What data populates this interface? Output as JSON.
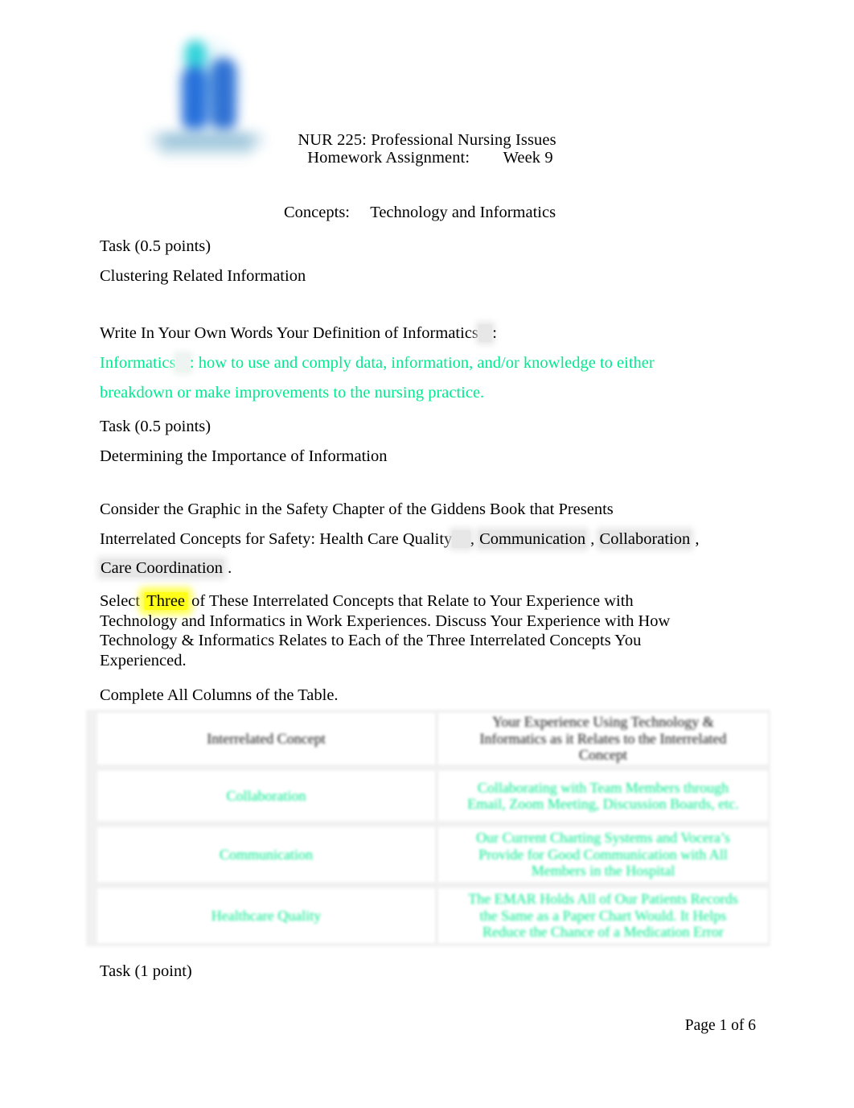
{
  "colors": {
    "green_text": "#00e98e",
    "yellow_highlight": "#ffff1a",
    "gray_highlight": "#e4e4e4",
    "logo_cyan": "#1ecfd6",
    "logo_blue": "#1565d8",
    "page_background": "#ffffff",
    "body_text": "#000000"
  },
  "logo": {
    "name": "institution-logo",
    "description": "blurred blue and cyan abstract mark with wordmark beneath"
  },
  "header": {
    "line1": "NUR 225: Professional Nursing Issues",
    "line2": "Homework Assignment:        Week 9",
    "concepts_label": "Concepts:",
    "concepts_value": "Technology and Informatics",
    "concepts_line": "Concepts:     Technology and Informatics"
  },
  "sections": [
    {
      "task_label": "Task (0.5 points)",
      "heading": "Clustering Related Information",
      "prompt_prefix": "Write In Your Own Words Your Definition of Informatics",
      "prompt_suffix": ":",
      "answer_term": "Informatics",
      "answer_body": ": how to use and comply data, information, and/or knowledge to either breakdown or make improvements to the nursing practice."
    },
    {
      "task_label": "Task (0.5 points)",
      "heading": "Determining the Importance of Information",
      "consider_line1": "Consider the Graphic in the Safety Chapter of the Giddens Book that Presents",
      "consider_line2_prefix": "Interrelated Concepts for Safety: Health Care Quality",
      "consider_concept_2": "Communication",
      "consider_concept_3": "Collaboration",
      "consider_concept_4": "Care Coordination",
      "select_prefix": "Select",
      "select_highlight": "Three",
      "select_body": "of These Interrelated Concepts that Relate to Your Experience with Technology and Informatics in Work Experiences. Discuss Your Experience with How Technology & Informatics Relates to Each of the Three Interrelated Concepts You Experienced.",
      "complete_instruction": "Complete All Columns of the Table."
    }
  ],
  "table": {
    "headers": {
      "col1": "Interrelated Concept",
      "col2_lines": [
        "Your Experience Using Technology &",
        "Informatics as it Relates to the Interrelated",
        "Concept"
      ]
    },
    "rows": [
      {
        "concept": "Collaboration",
        "experience_lines": [
          "Collaborating with Team Members through",
          "Email, Zoom Meeting, Discussion Boards, etc."
        ]
      },
      {
        "concept": "Communication",
        "experience_lines": [
          "Our Current Charting Systems and Vocera’s",
          "Provide for Good Communication with All",
          "Members in the Hospital"
        ]
      },
      {
        "concept": "Healthcare Quality",
        "experience_lines": [
          "The EMAR Holds All of Our Patients Records",
          "the Same as a Paper Chart Would. It Helps",
          "Reduce the Chance of a Medication Error"
        ]
      }
    ]
  },
  "final_task": {
    "label": "Task (1 point)"
  },
  "footer": {
    "page_indicator": "Page 1 of 6"
  }
}
